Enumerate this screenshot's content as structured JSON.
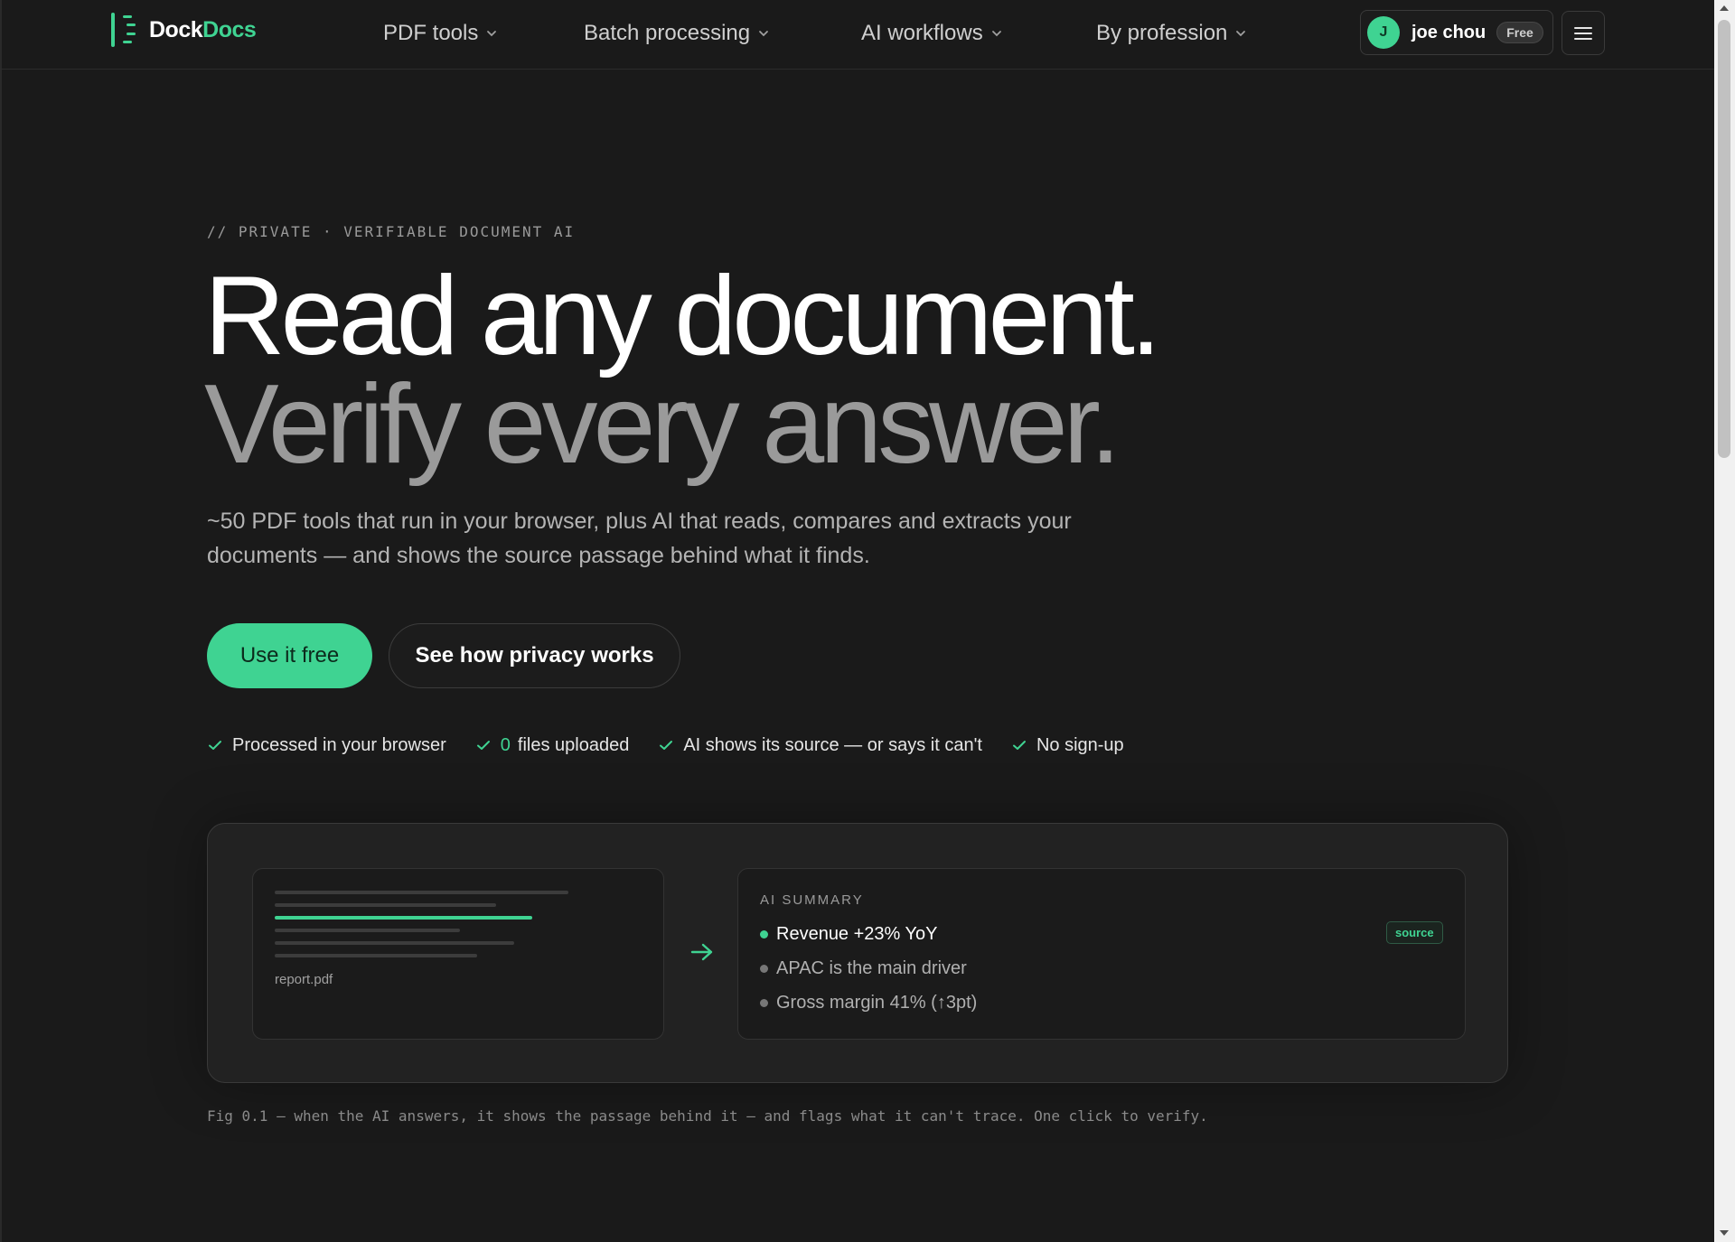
{
  "brand": {
    "name_part1": "Dock",
    "name_part2": "Docs",
    "accent_color": "#3fd392",
    "logo_icon": "dockdocs-logo-icon"
  },
  "nav": {
    "items": [
      {
        "label": "PDF tools",
        "icon": "chevron-down-icon"
      },
      {
        "label": "Batch processing",
        "icon": "chevron-down-icon"
      },
      {
        "label": "AI workflows",
        "icon": "chevron-down-icon"
      },
      {
        "label": "By profession",
        "icon": "chevron-down-icon"
      }
    ],
    "user": {
      "initial": "J",
      "name": "joe chou",
      "plan": "Free"
    },
    "menu_icon": "hamburger-menu-icon"
  },
  "hero": {
    "eyebrow": "// PRIVATE · VERIFIABLE DOCUMENT AI",
    "headline_line1": "Read any document.",
    "headline_line2": "Verify every answer.",
    "subtitle": "~50 PDF tools that run in your browser, plus AI that reads, compares and extracts your documents — and shows the source passage behind what it finds.",
    "primary_cta": "Use it free",
    "secondary_cta": "See how privacy works"
  },
  "checks": [
    {
      "text": "Processed in your browser"
    },
    {
      "accent": "0",
      "text": "files uploaded"
    },
    {
      "text": "AI shows its source — or says it can't"
    },
    {
      "text": "No sign-up"
    }
  ],
  "demo": {
    "file_name": "report.pdf",
    "summary_title": "AI SUMMARY",
    "items": [
      {
        "text": "Revenue +23% YoY"
      },
      {
        "text": "APAC is the main driver"
      },
      {
        "text": "Gross margin 41% (↑3pt)"
      }
    ],
    "source_label": "source"
  },
  "caption": "Fig 0.1 — when the AI answers, it shows the passage behind it — and flags what it can't trace. One click to verify."
}
